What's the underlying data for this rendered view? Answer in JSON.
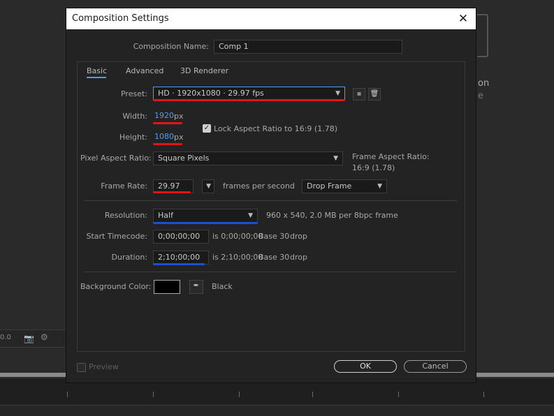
{
  "dialog": {
    "title": "Composition Settings",
    "close_glyph": "✕",
    "composition_name_label": "Composition Name:",
    "composition_name_value": "Comp 1",
    "tabs": [
      {
        "label": "Basic"
      },
      {
        "label": "Advanced"
      },
      {
        "label": "3D Renderer"
      }
    ],
    "preset": {
      "label": "Preset:",
      "value": "HD  ·  1920x1080 · 29.97 fps"
    },
    "width": {
      "label": "Width:",
      "value": "1920",
      "unit": "px"
    },
    "height": {
      "label": "Height:",
      "value": "1080",
      "unit": "px"
    },
    "lock_aspect": {
      "label": "Lock Aspect Ratio to 16:9 (1.78)",
      "checked": true
    },
    "pixel_aspect": {
      "label": "Pixel Aspect Ratio:",
      "value": "Square Pixels"
    },
    "frame_aspect": {
      "line1": "Frame Aspect Ratio:",
      "line2": "16:9 (1.78)"
    },
    "frame_rate": {
      "label": "Frame Rate:",
      "value": "29.97",
      "unit_text": "frames per second",
      "drop_value": "Drop Frame"
    },
    "resolution": {
      "label": "Resolution:",
      "value": "Half",
      "info": "960 x 540, 2.0 MB per 8bpc frame"
    },
    "start_timecode": {
      "label": "Start Timecode:",
      "value": "0;00;00;00",
      "info_is": "is 0;00;00;00",
      "base": "Base 30",
      "drop": "drop"
    },
    "duration": {
      "label": "Duration:",
      "value": "2;10;00;00",
      "info_is": "is 2;10;00;00",
      "base": "Base 30",
      "drop": "drop"
    },
    "background_color": {
      "label": "Background Color:",
      "color": "#000000",
      "name": "Black"
    },
    "preview_label": "Preview",
    "ok_label": "OK",
    "cancel_label": "Cancel"
  },
  "background_app": {
    "text_on": "on",
    "text_e": "e",
    "toolbar_num": "0.0"
  },
  "annotation_colors": {
    "red": "#e0141a",
    "blue": "#1a4fd6"
  }
}
